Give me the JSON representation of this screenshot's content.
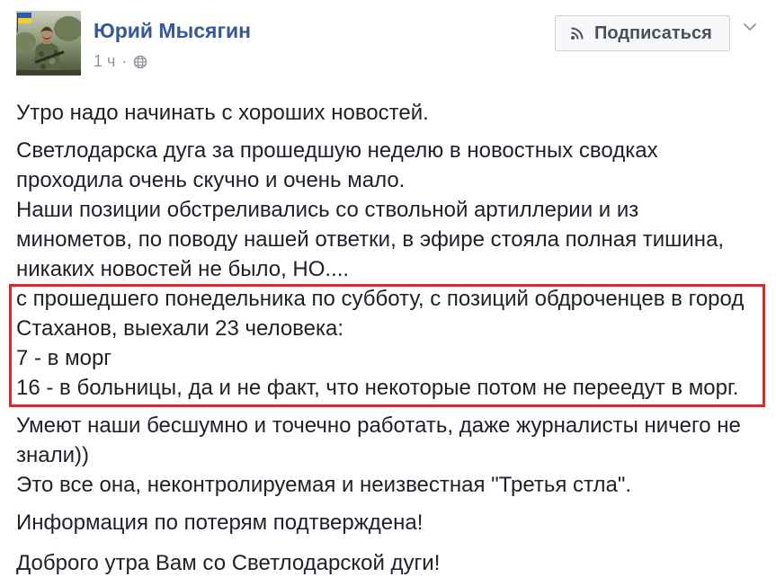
{
  "post": {
    "author": {
      "name": "Юрий Мысягин"
    },
    "timestamp": "1 ч",
    "separator": "·",
    "subscribe": {
      "label": "Подписаться"
    },
    "paragraphs": [
      {
        "lines": [
          "Утро надо начинать с хороших новостей."
        ]
      },
      {
        "lines": [
          "Светлодарска дуга за прошедшую неделю в новостных сводках",
          "проходила очень скучно и очень мало.",
          "Наши позиции обстреливались со ствольной артиллерии и из",
          "минометов, по поводу нашей ответки, в эфире стояла полная тишина,",
          "никаких новостей не было, НО....",
          "с прошедшего понедельника по субботу, с позиций обдроченцев в город",
          "Стаханов, выехали 23 человека:",
          "7 - в морг",
          "16 - в больницы, да и не факт, что некоторые потом не переедут в морг."
        ]
      },
      {
        "lines": [
          "Умеют наши бесшумно и точечно работать, даже журналисты ничего не",
          "знали))",
          "Это все она, неконтролируемая и неизвестная \"Третья стла\"."
        ]
      },
      {
        "lines": [
          "Информация по потерям подтверждена!"
        ]
      },
      {
        "lines": [
          "Доброго утра Вам со Светлодарской дуги!"
        ]
      }
    ]
  },
  "icons": {
    "avatar": "profile-photo",
    "privacy": "globe-icon",
    "subscribe": "rss-icon",
    "menu": "chevron-down-icon"
  },
  "colors": {
    "link": "#365899",
    "text": "#1d2129",
    "meta": "#90949c",
    "highlight": "#e0262c",
    "btn-bg": "#f6f7f9",
    "btn-border": "#ccd0d5",
    "btn-text": "#4b4f56"
  }
}
